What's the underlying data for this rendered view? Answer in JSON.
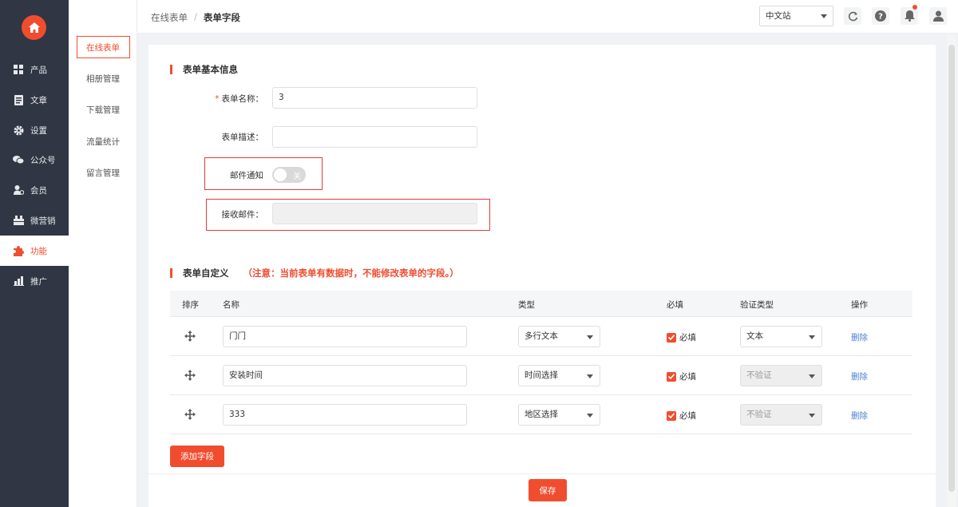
{
  "sidebar": {
    "items": [
      {
        "label": "产品",
        "icon": "grid-icon"
      },
      {
        "label": "文章",
        "icon": "document-icon"
      },
      {
        "label": "设置",
        "icon": "gear-icon"
      },
      {
        "label": "公众号",
        "icon": "wechat-icon"
      },
      {
        "label": "会员",
        "icon": "member-icon"
      },
      {
        "label": "微营销",
        "icon": "marketing-icon"
      },
      {
        "label": "功能",
        "icon": "puzzle-icon"
      },
      {
        "label": "推广",
        "icon": "chart-icon"
      }
    ],
    "active_index": 6
  },
  "subnav": {
    "items": [
      "在线表单",
      "相册管理",
      "下载管理",
      "流量统计",
      "留言管理"
    ]
  },
  "header": {
    "breadcrumb_parent": "在线表单",
    "breadcrumb_sep": "/",
    "breadcrumb_current": "表单字段",
    "site_select": "中文站"
  },
  "basic": {
    "title": "表单基本信息",
    "name_label": "表单名称：",
    "name_value": "3",
    "desc_label": "表单描述：",
    "desc_value": "",
    "email_notify_label": "邮件通知",
    "toggle_label": "关",
    "receive_label": "接收邮件：",
    "receive_value": ""
  },
  "custom": {
    "title": "表单自定义",
    "note": "（注意：当前表单有数据时，不能修改表单的字段。）"
  },
  "table": {
    "headers": [
      "排序",
      "名称",
      "类型",
      "必填",
      "验证类型",
      "操作"
    ],
    "rows": [
      {
        "name": "门门",
        "type": "多行文本",
        "required": "必填",
        "validate": "文本",
        "action": "删除"
      },
      {
        "name": "安装时间",
        "type": "时间选择",
        "required": "必填",
        "validate": "不验证",
        "action": "删除"
      },
      {
        "name": "333",
        "type": "地区选择",
        "required": "必填",
        "validate": "不验证",
        "action": "删除"
      }
    ]
  },
  "buttons": {
    "add_field": "添加字段",
    "save": "保存"
  },
  "colors": {
    "accent": "#f04d2f",
    "sidebar_bg": "#303643",
    "link": "#4d7fd1"
  }
}
